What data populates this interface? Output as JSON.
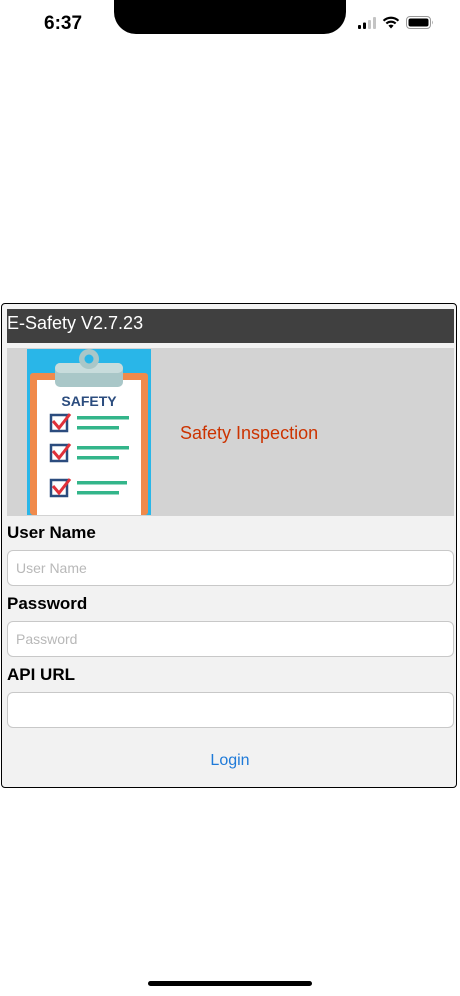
{
  "status_bar": {
    "time": "6:37"
  },
  "app": {
    "title": "E-Safety V2.7.23"
  },
  "banner": {
    "heading": "Safety Inspection",
    "logo_label": "SAFETY"
  },
  "form": {
    "username_label": "User Name",
    "username_placeholder": "User Name",
    "username_value": "",
    "password_label": "Password",
    "password_placeholder": "Password",
    "password_value": "",
    "api_url_label": "API URL",
    "api_url_placeholder": "",
    "api_url_value": ""
  },
  "actions": {
    "login_label": "Login"
  },
  "colors": {
    "title_bar": "#404040",
    "banner_bg": "#d3d3d3",
    "banner_text": "#cc3300",
    "link": "#1f7ad8",
    "card_bg": "#f2f2f2"
  },
  "icons": [
    "signal-icon",
    "wifi-icon",
    "battery-icon",
    "safety-clipboard-logo"
  ]
}
